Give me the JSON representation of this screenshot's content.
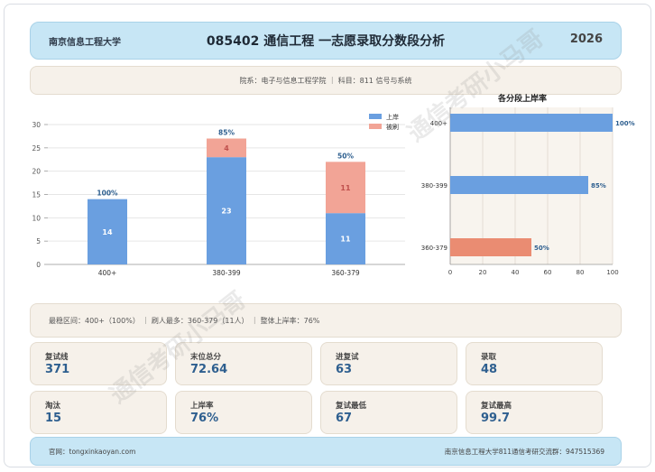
{
  "header": {
    "university": "南京信息工程大学",
    "title": "085402 通信工程 一志愿录取分数段分析",
    "year": "2026"
  },
  "info": {
    "text": "院系：电子与信息工程学院 ｜ 科目：811 信号与系统"
  },
  "chart_data": [
    {
      "type": "bar",
      "stacked": true,
      "categories": [
        "400+",
        "380-399",
        "360-379"
      ],
      "series": [
        {
          "name": "上岸",
          "values": [
            14,
            23,
            11
          ],
          "color": "#6a9fe0"
        },
        {
          "name": "被刷",
          "values": [
            0,
            4,
            11
          ],
          "color": "#f2a496"
        }
      ],
      "top_labels": [
        "100%",
        "85%",
        "50%"
      ],
      "ylim": [
        0,
        30
      ],
      "yticks": [
        0,
        5,
        10,
        15,
        20,
        25,
        30
      ],
      "legend": "top-right",
      "grid": true
    },
    {
      "type": "bar",
      "orientation": "horizontal",
      "title": "各分段上岸率",
      "categories": [
        "400+",
        "380-399",
        "360-379"
      ],
      "values": [
        100,
        85,
        50
      ],
      "value_labels": [
        "100%",
        "85%",
        "50%"
      ],
      "colors": [
        "#6a9fe0",
        "#6a9fe0",
        "#ea8c72"
      ],
      "xlim": [
        0,
        100
      ],
      "xticks": [
        0,
        20,
        40,
        60,
        80,
        100
      ],
      "grid": true
    }
  ],
  "stats_line": "最稳区间：400+（100%） ｜ 刷人最多：360-379（11人） ｜ 整体上岸率：76%",
  "boxes": [
    {
      "label": "复试线",
      "value": "371"
    },
    {
      "label": "末位总分",
      "value": "72.64"
    },
    {
      "label": "进复试",
      "value": "63"
    },
    {
      "label": "录取",
      "value": "48"
    },
    {
      "label": "淘汰",
      "value": "15"
    },
    {
      "label": "上岸率",
      "value": "76%"
    },
    {
      "label": "复试最低",
      "value": "67"
    },
    {
      "label": "复试最高",
      "value": "99.7"
    }
  ],
  "footer": {
    "left": "官网：tongxinkaoyan.com",
    "right": "南京信息工程大学811通信考研交流群：947515369"
  },
  "watermark": "通信考研小马哥"
}
